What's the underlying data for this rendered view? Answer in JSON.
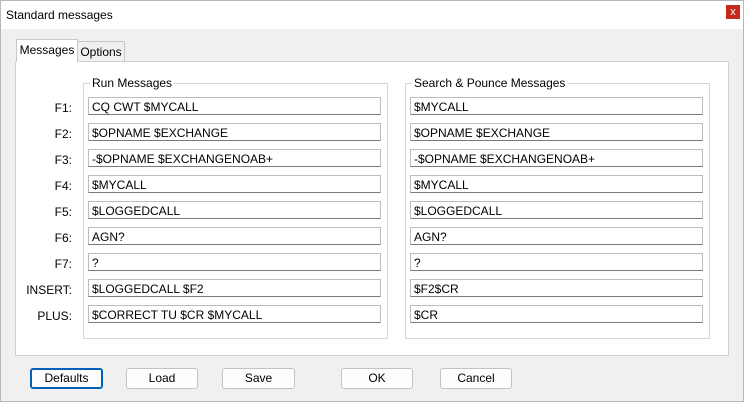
{
  "window": {
    "title": "Standard messages",
    "close_glyph": "x"
  },
  "tabs": [
    {
      "label": "Messages",
      "active": true
    },
    {
      "label": "Options",
      "active": false
    }
  ],
  "groups": {
    "run": {
      "label": "Run Messages"
    },
    "sp": {
      "label": "Search & Pounce Messages"
    }
  },
  "rows": [
    {
      "key": "F1:",
      "run": "CQ CWT $MYCALL",
      "sp": "$MYCALL"
    },
    {
      "key": "F2:",
      "run": "$OPNAME $EXCHANGE",
      "sp": "$OPNAME $EXCHANGE"
    },
    {
      "key": "F3:",
      "run": "-$OPNAME $EXCHANGENOAB+",
      "sp": "-$OPNAME $EXCHANGENOAB+"
    },
    {
      "key": "F4:",
      "run": "$MYCALL",
      "sp": "$MYCALL"
    },
    {
      "key": "F5:",
      "run": "$LOGGEDCALL",
      "sp": "$LOGGEDCALL"
    },
    {
      "key": "F6:",
      "run": "AGN?",
      "sp": "AGN?"
    },
    {
      "key": "F7:",
      "run": "?",
      "sp": "?"
    },
    {
      "key": "INSERT:",
      "run": "$LOGGEDCALL $F2",
      "sp": "$F2$CR"
    },
    {
      "key": "PLUS:",
      "run": "$CORRECT TU $CR $MYCALL",
      "sp": "$CR"
    }
  ],
  "buttons": {
    "defaults": "Defaults",
    "load": "Load",
    "save": "Save",
    "ok": "OK",
    "cancel": "Cancel"
  },
  "colors": {
    "close_bg": "#c42b1c",
    "default_border": "#005fb8"
  }
}
